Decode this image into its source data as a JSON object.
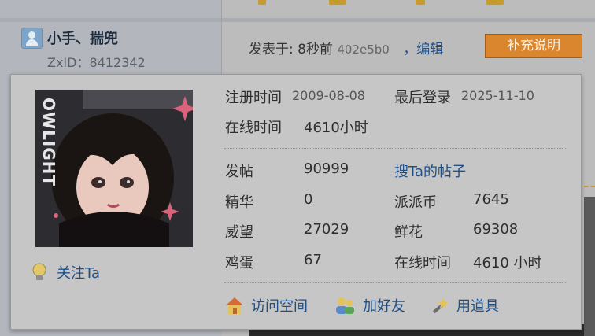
{
  "header": {
    "username": "小手、揣兜",
    "zxid": "ZxID：8412342"
  },
  "post": {
    "posted_prefix": "发表于: 8秒前",
    "post_hash": "402e5b0",
    "edit_label": "，编辑",
    "supplement_label": "补充说明"
  },
  "profile": {
    "image_caption": "OWLIGHT",
    "follow_label": "关注Ta",
    "register_label": "注册时间",
    "register_date": "2009-08-08",
    "last_login_label": "最后登录",
    "last_login_date": "2025-11-10",
    "online_label": "在线时间",
    "online_value": "4610小时"
  },
  "stats": {
    "posts_label": "发帖",
    "posts_value": "90999",
    "search_posts_label": "搜Ta的帖子",
    "essence_label": "精华",
    "essence_value": "0",
    "coins_label": "派派币",
    "coins_value": "7645",
    "prestige_label": "威望",
    "prestige_value": "27029",
    "flowers_label": "鲜花",
    "flowers_value": "69308",
    "eggs_label": "鸡蛋",
    "eggs_value": "67",
    "online_label": "在线时间",
    "online_value": "4610 小时"
  },
  "actions": {
    "visit_space": "访问空间",
    "add_friend": "加好友",
    "use_item": "用道具"
  },
  "colors": {
    "link": "#1f4f86",
    "supplement_button": "#d9862e",
    "popup_background": "#c6c6c6"
  }
}
